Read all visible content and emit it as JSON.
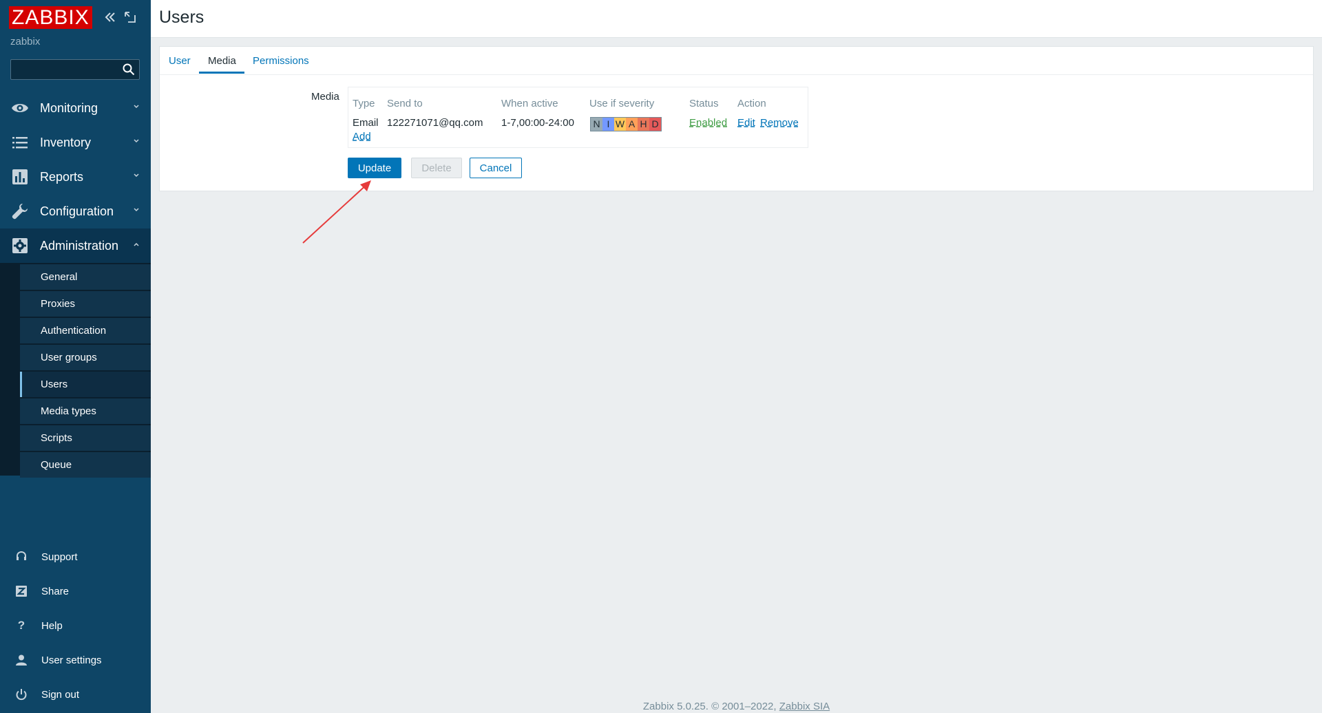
{
  "sidebar": {
    "logo": "ZABBIX",
    "server_name": "zabbix",
    "search": {
      "value": "",
      "placeholder": ""
    },
    "menu": [
      {
        "label": "Monitoring",
        "icon": "eye-icon"
      },
      {
        "label": "Inventory",
        "icon": "list-icon"
      },
      {
        "label": "Reports",
        "icon": "bar-chart-icon"
      },
      {
        "label": "Configuration",
        "icon": "wrench-icon"
      },
      {
        "label": "Administration",
        "icon": "gear-icon"
      }
    ],
    "submenu": [
      "General",
      "Proxies",
      "Authentication",
      "User groups",
      "Users",
      "Media types",
      "Scripts",
      "Queue"
    ],
    "bottom": [
      {
        "label": "Support",
        "icon": "headset-icon"
      },
      {
        "label": "Share",
        "icon": "share-icon"
      },
      {
        "label": "Help",
        "icon": "help-icon"
      },
      {
        "label": "User settings",
        "icon": "user-icon"
      },
      {
        "label": "Sign out",
        "icon": "power-icon"
      }
    ]
  },
  "header": {
    "title": "Users"
  },
  "tabs": [
    "User",
    "Media",
    "Permissions"
  ],
  "media": {
    "label": "Media",
    "columns": [
      "Type",
      "Send to",
      "When active",
      "Use if severity",
      "Status",
      "Action"
    ],
    "row": {
      "type": "Email",
      "send_to": "122271071@qq.com",
      "when_active": "1-7,00:00-24:00",
      "severity": [
        "N",
        "I",
        "W",
        "A",
        "H",
        "D"
      ],
      "status": "Enabled",
      "edit": "Edit",
      "remove": "Remove"
    },
    "add": "Add"
  },
  "buttons": {
    "update": "Update",
    "delete": "Delete",
    "cancel": "Cancel"
  },
  "colors": {
    "severity": [
      "#97aab3",
      "#7499ff",
      "#ffc859",
      "#ffa059",
      "#e97659",
      "#e45959"
    ],
    "accent": "#0275b8"
  },
  "footer": {
    "text": "Zabbix 5.0.25. © 2001–2022, ",
    "link": "Zabbix SIA"
  }
}
